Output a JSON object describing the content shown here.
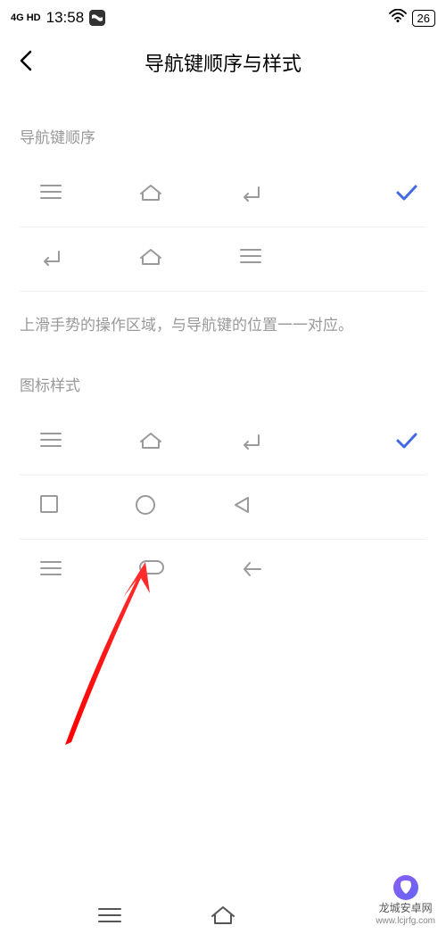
{
  "statusBar": {
    "signal": "4G HD",
    "time": "13:58",
    "battery": "26"
  },
  "header": {
    "title": "导航键顺序与样式"
  },
  "sections": {
    "orderLabel": "导航键顺序",
    "orderDescription": "上滑手势的操作区域，与导航键的位置一一对应。",
    "styleLabel": "图标样式"
  },
  "watermark": {
    "name": "龙城安卓网",
    "url": "www.lcjrfg.com"
  }
}
